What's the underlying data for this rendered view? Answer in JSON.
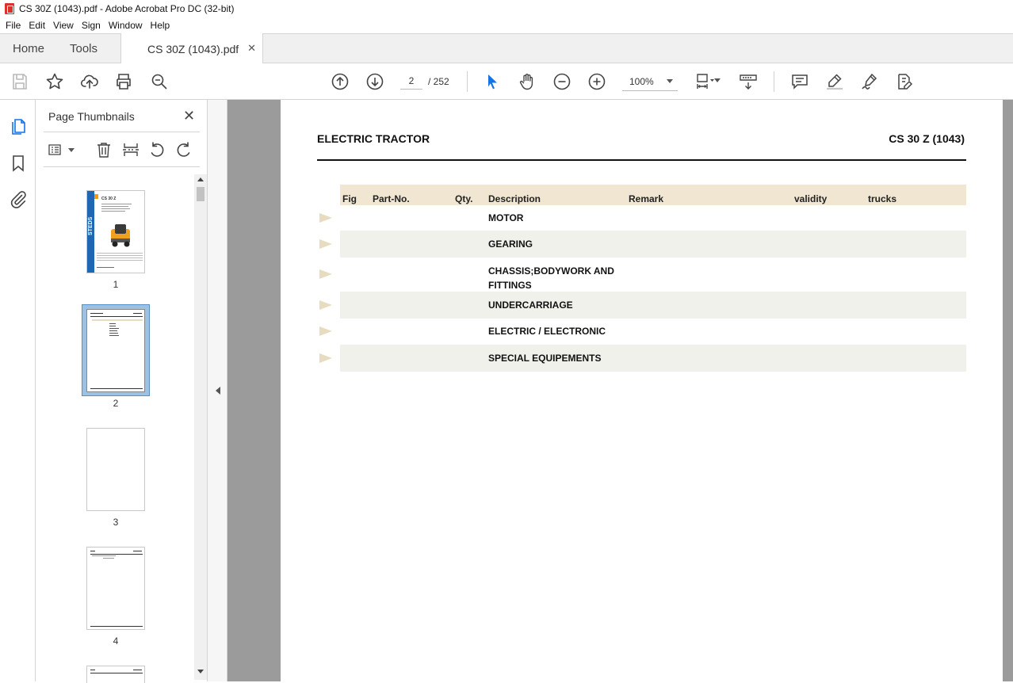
{
  "window": {
    "title": "CS 30Z (1043).pdf - Adobe Acrobat Pro DC (32-bit)"
  },
  "menu": [
    "File",
    "Edit",
    "View",
    "Sign",
    "Window",
    "Help"
  ],
  "tabs": {
    "home": "Home",
    "tools": "Tools",
    "document": "CS 30Z (1043).pdf"
  },
  "toolbar": {
    "page_current": "2",
    "page_total": "/ 252",
    "zoom": "100%"
  },
  "panel": {
    "title": "Page Thumbnails"
  },
  "thumbnails": [
    {
      "num": "1",
      "cover_title": "CS 30 Z",
      "cover_brand": "STEDS"
    },
    {
      "num": "2"
    },
    {
      "num": "3"
    },
    {
      "num": "4"
    }
  ],
  "document": {
    "title_left": "ELECTRIC TRACTOR",
    "title_right": "CS 30 Z (1043)",
    "columns": [
      "Fig",
      "Part-No.",
      "Qty.",
      "Description",
      "Remark",
      "validity",
      "trucks"
    ],
    "rows": [
      {
        "description": "MOTOR"
      },
      {
        "description": "GEARING"
      },
      {
        "description": "CHASSIS;BODYWORK AND FITTINGS"
      },
      {
        "description": "UNDERCARRIAGE"
      },
      {
        "description": "ELECTRIC / ELECTRONIC"
      },
      {
        "description": "SPECIAL EQUIPEMENTS"
      }
    ]
  },
  "colors": {
    "accent": "#1473e6",
    "header_band": "#f0e6d2",
    "alt_row": "#f1f1ec",
    "viewer_bg": "#9b9b9b"
  }
}
